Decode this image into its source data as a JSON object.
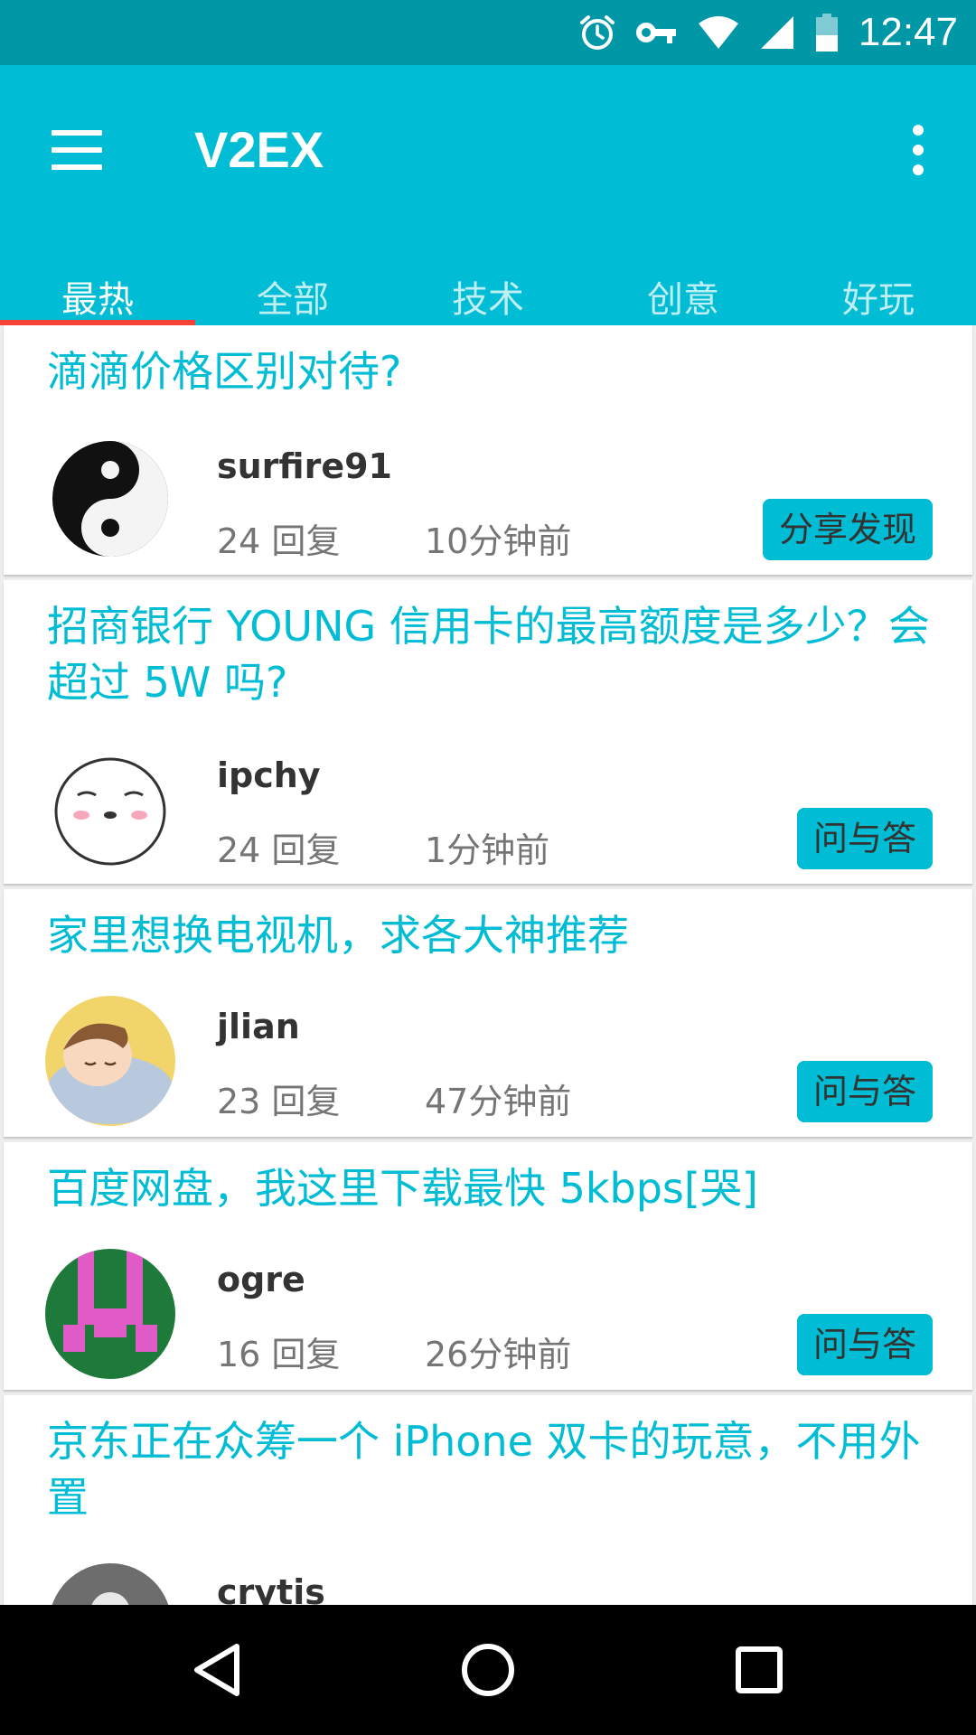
{
  "status_bar": {
    "time": "12:47",
    "icons": [
      "alarm-icon",
      "vpn-key-icon",
      "wifi-icon",
      "signal-icon",
      "battery-icon"
    ]
  },
  "app_bar": {
    "title": "V2EX",
    "menu_icon": "hamburger-menu-icon",
    "overflow_icon": "more-vert-icon",
    "background_color": "#00bcd4"
  },
  "tabs": {
    "items": [
      {
        "label": "最热",
        "active": true
      },
      {
        "label": "全部",
        "active": false
      },
      {
        "label": "技术",
        "active": false
      },
      {
        "label": "创意",
        "active": false
      },
      {
        "label": "好玩",
        "active": false
      }
    ],
    "indicator_color": "#f44336"
  },
  "posts": [
    {
      "title": "滴滴价格区别对待?",
      "username": "surfire91",
      "replies": "24 回复",
      "time": "10分钟前",
      "node": "分享发现"
    },
    {
      "title": "招商银行 YOUNG 信用卡的最高额度是多少？会超过 5W 吗?",
      "username": "ipchy",
      "replies": "24 回复",
      "time": "1分钟前",
      "node": "问与答"
    },
    {
      "title": "家里想换电视机，求各大神推荐",
      "username": "jlian",
      "replies": "23 回复",
      "time": "47分钟前",
      "node": "问与答"
    },
    {
      "title": "百度网盘，我这里下载最快 5kbps[哭]",
      "username": "ogre",
      "replies": "16 回复",
      "time": "26分钟前",
      "node": "问与答"
    },
    {
      "title": "京东正在众筹一个 iPhone 双卡的玩意，不用外置",
      "username": "crytis",
      "replies": "",
      "time": "",
      "node": ""
    }
  ],
  "nav_bar": {
    "icons": [
      "back-icon",
      "home-icon",
      "recents-icon"
    ]
  }
}
